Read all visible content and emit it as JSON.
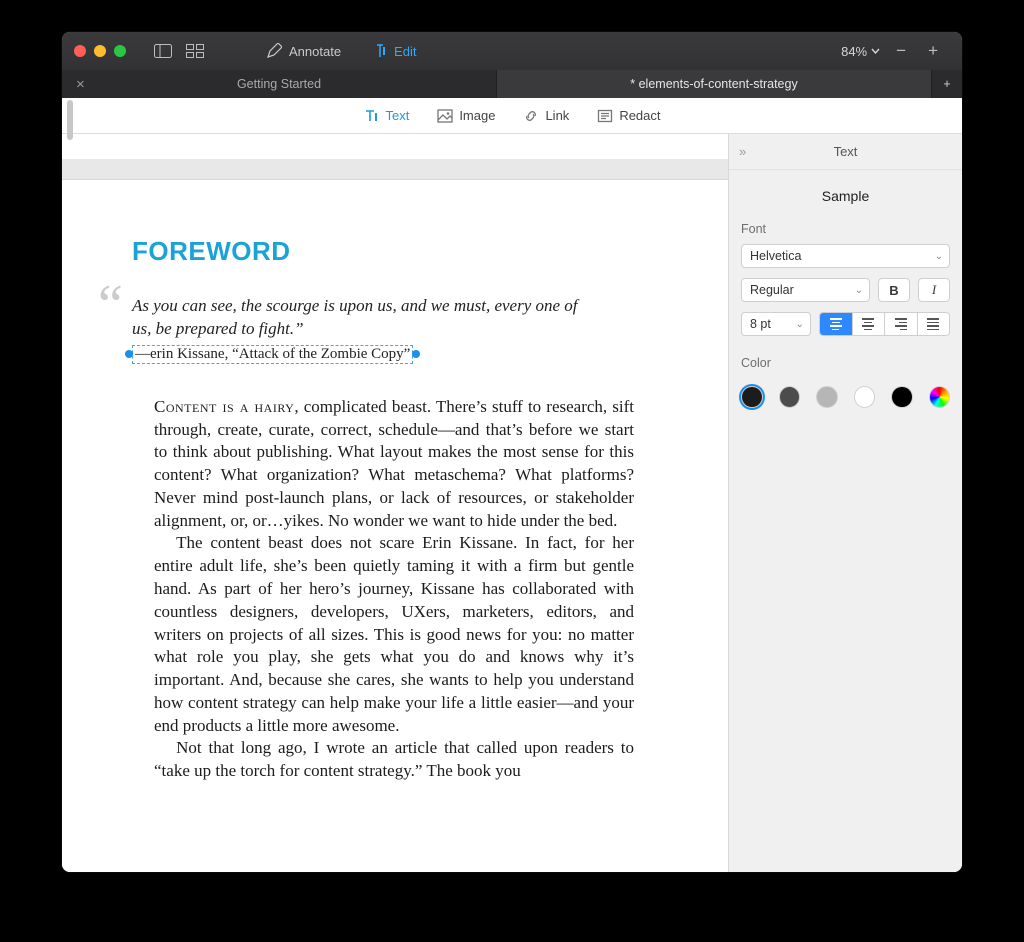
{
  "titlebar": {
    "annotate_label": "Annotate",
    "edit_label": "Edit",
    "zoom": "84%"
  },
  "tabs": {
    "getting_started": "Getting Started",
    "active": "* elements-of-content-strategy"
  },
  "toolbar": {
    "text": "Text",
    "image": "Image",
    "link": "Link",
    "redact": "Redact"
  },
  "document": {
    "heading": "FOREWORD",
    "quote_line1": "As you can see, the scourge is upon us, and we must, every one of",
    "quote_line2": "us, be prepared to fight.”",
    "attribution_dash": "—",
    "attribution_name": "erin Kissane",
    "attribution_sep": ", ",
    "attribution_title": "“Attack of the Zombie Copy”",
    "para1_lead": "Content is a hairy",
    "para1_rest": ", complicated beast. There’s stuff to re­search, sift through, create, curate, correct, schedule—and that’s before we start to think about publishing. What layout makes the most sense for this content? What organization? What metaschema? What platforms? Never mind post-launch plans, or lack of resources, or stakeholder alignment, or, or…yikes. No wonder we want to hide under the bed.",
    "para2": "The content beast does not scare Erin Kissane. In fact, for her entire adult life, she’s been quietly taming it with a firm but gentle hand. As part of her hero’s journey, Kissane has collaborated with countless designers, developers, UXers, marketers, editors, and writers on projects of all sizes. This is good news for you: no matter what role you play, she gets what you do and knows why it’s important. And, because she cares, she wants to help you understand how content strategy can help make your life a little easier—and your end products a little more awesome.",
    "para3": "Not that long ago, I wrote an article that called upon read­ers to “take up the torch for content strategy.” The book you"
  },
  "inspector": {
    "title": "Text",
    "sample": "Sample",
    "font_label": "Font",
    "font_family": "Helvetica",
    "font_style": "Regular",
    "font_size": "8 pt",
    "color_label": "Color",
    "swatches": [
      {
        "fill": "#1c1c1c",
        "selected": true
      },
      {
        "fill": "#4c4c4c",
        "selected": false
      },
      {
        "fill": "#b6b6b6",
        "selected": false
      },
      {
        "fill": "#ffffff",
        "selected": false
      },
      {
        "fill": "#000000",
        "selected": false
      },
      {
        "fill": "rainbow",
        "selected": false
      }
    ]
  }
}
